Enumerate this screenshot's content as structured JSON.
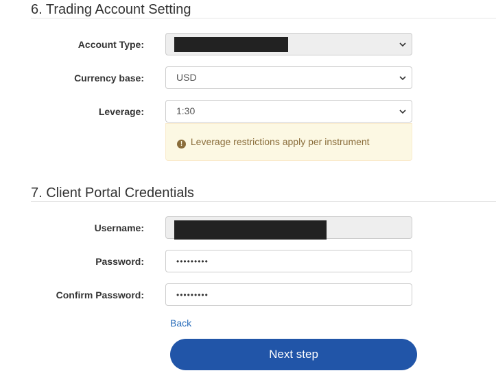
{
  "trading": {
    "title": "6. Trading Account Setting",
    "account_type_label": "Account Type:",
    "account_type_value": "",
    "currency_label": "Currency base:",
    "currency_value": "USD",
    "leverage_label": "Leverage:",
    "leverage_value": "1:30",
    "leverage_warning": "Leverage restrictions apply per instrument"
  },
  "credentials": {
    "title": "7. Client Portal Credentials",
    "username_label": "Username:",
    "username_value": "",
    "password_label": "Password:",
    "password_value": "•••••••••",
    "confirm_label": "Confirm Password:",
    "confirm_value": "•••••••••"
  },
  "actions": {
    "back_label": "Back",
    "next_label": "Next step"
  },
  "colors": {
    "primary": "#2155a8",
    "link": "#2a6ebb",
    "warning_bg": "#fcf8e3",
    "warning_text": "#8a6d3b"
  },
  "icons": {
    "warning": "exclamation-circle-icon",
    "dropdown": "chevron-down-icon"
  }
}
